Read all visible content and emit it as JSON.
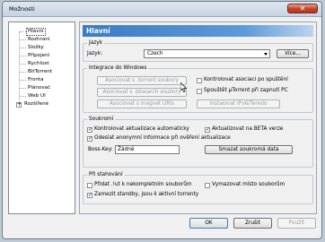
{
  "window": {
    "title": "Možnosti",
    "close_label": "✕"
  },
  "tree": {
    "items": [
      {
        "label": "Hlavní"
      },
      {
        "label": "Rozhraní"
      },
      {
        "label": "Složky"
      },
      {
        "label": "Připojení"
      },
      {
        "label": "Rychlost"
      },
      {
        "label": "BitTorrent"
      },
      {
        "label": "Fronta"
      },
      {
        "label": "Plánovač"
      },
      {
        "label": "Web UI"
      },
      {
        "label": "Rozšířené"
      }
    ],
    "expander": "+"
  },
  "panel": {
    "header": "Hlavní",
    "language": {
      "group_title": "Jazyk",
      "label": "Jazyk:",
      "selected": "Czech",
      "more_button": "Více..."
    },
    "windows": {
      "group_title": "Integrace do Windows",
      "assoc_torrent": "Asociovat s .torrent soubory",
      "assoc_btsearch": "Asociovat s .btsearch soubory",
      "assoc_magnet": "Asociovat s magnet URIs",
      "check_assoc": "Kontrolovat asociaci po spuštění",
      "start_with_pc": "Spouštět µTorrent při zapnutí PC",
      "install_ipv6": "Instalovat IPv6/Teredo"
    },
    "privacy": {
      "group_title": "Soukromí",
      "auto_update": "Kontrolovat aktualizace automaticky",
      "beta_update": "Aktualizovat na BETA verze",
      "send_anon": "Odeslat anonymní informace při ověření aktualizace",
      "boss_key_label": "Boss-Key:",
      "boss_key_value": "Žádné",
      "clear_private": "Smazat soukromá data"
    },
    "download": {
      "group_title": "Při stahování",
      "append_ut": "Přidat .!ut k nekompletním souborům",
      "prealloc": "Vymazovat místo souborům",
      "prevent_standby": "Zamezit standby, jsou-li aktivní torrenty"
    }
  },
  "footer": {
    "ok": "OK",
    "cancel": "Zrušit",
    "apply": "Použít"
  },
  "check_mark": "✓"
}
